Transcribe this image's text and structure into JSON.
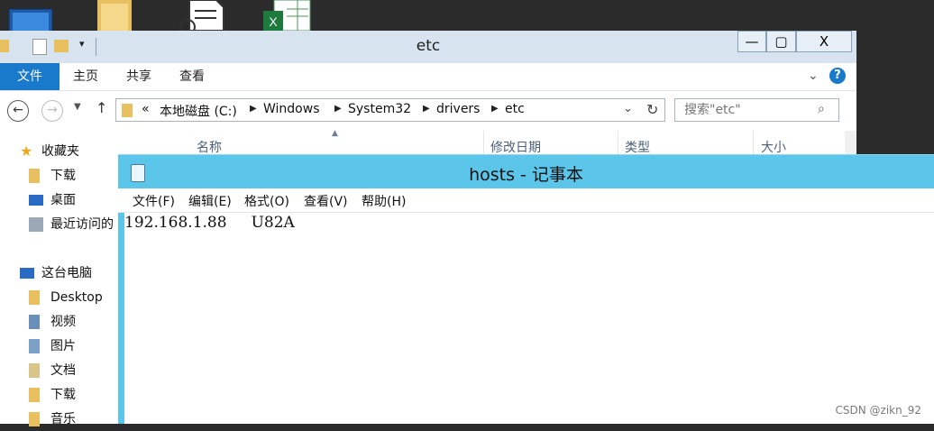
{
  "desktop": {
    "icons": [
      "computer-icon",
      "folder-icon",
      "document-icon",
      "excel-icon"
    ]
  },
  "explorer": {
    "title": "etc",
    "window_buttons": {
      "minimize": "—",
      "maximize": "▢",
      "close": "X"
    },
    "ribbon_tabs": [
      "文件",
      "主页",
      "共享",
      "查看"
    ],
    "breadcrumb": {
      "overflow": "«",
      "items": [
        "本地磁盘 (C:)",
        "Windows",
        "System32",
        "drivers",
        "etc"
      ]
    },
    "search_placeholder": "搜索\"etc\"",
    "nav": {
      "favorites_header": "收藏夹",
      "favorites": [
        "下载",
        "桌面",
        "最近访问的"
      ],
      "pc_header": "这台电脑",
      "pc_items": [
        "Desktop",
        "视频",
        "图片",
        "文档",
        "下载",
        "音乐"
      ]
    },
    "columns": [
      "名称",
      "修改日期",
      "类型",
      "大小"
    ]
  },
  "notepad": {
    "title": "hosts - 记事本",
    "menus": [
      "文件(F)",
      "编辑(E)",
      "格式(O)",
      "查看(V)",
      "帮助(H)"
    ],
    "content": "192.168.1.88     U82A"
  },
  "watermark": "CSDN @zikn_92",
  "colors": {
    "explorer_title": "#d7e4f0",
    "ribbon_file_tab": "#1979ca",
    "notepad_title": "#5bc5ea"
  }
}
